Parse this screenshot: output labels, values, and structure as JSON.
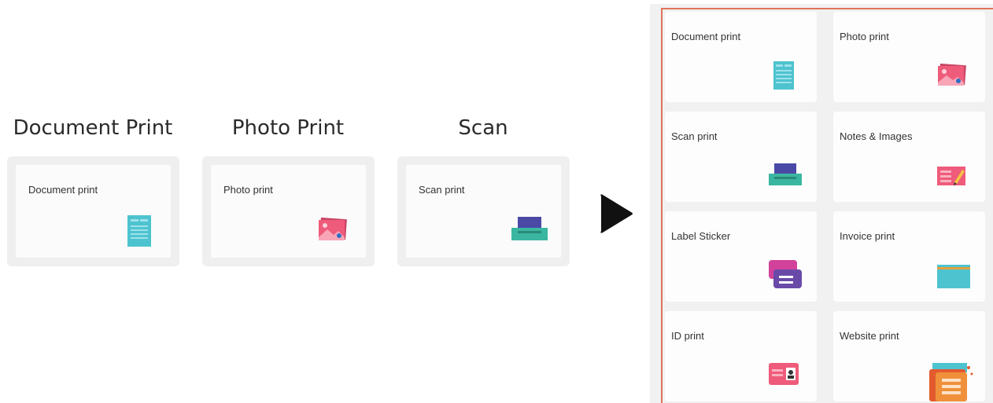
{
  "columns": [
    {
      "title": "Document Print",
      "card_label": "Document print",
      "icon": "document-icon"
    },
    {
      "title": "Photo Print",
      "card_label": "Photo print",
      "icon": "photo-icon"
    },
    {
      "title": "Scan",
      "card_label": "Scan print",
      "icon": "scanner-icon"
    }
  ],
  "arrow_icon": "arrow-right-icon",
  "grid": {
    "tiles": [
      {
        "label": "Document print",
        "icon": "document-icon"
      },
      {
        "label": "Photo print",
        "icon": "photo-icon"
      },
      {
        "label": "Scan print",
        "icon": "scanner-icon"
      },
      {
        "label": "Notes & Images",
        "icon": "notes-image-icon"
      },
      {
        "label": "Label Sticker",
        "icon": "label-sticker-icon"
      },
      {
        "label": "Invoice print",
        "icon": "invoice-icon"
      },
      {
        "label": "ID print",
        "icon": "id-card-icon"
      },
      {
        "label": "Website print",
        "icon": "website-icon"
      }
    ],
    "highlight_color": "#e0745a"
  },
  "colors": {
    "document": "#4ec3d0",
    "photo": "#ef5b7a",
    "scanner_top": "#4a4aa6",
    "scanner_base": "#3bb6a0",
    "label": "#8e4fb8",
    "invoice": "#4ec3d0",
    "website": "#f0903a"
  }
}
